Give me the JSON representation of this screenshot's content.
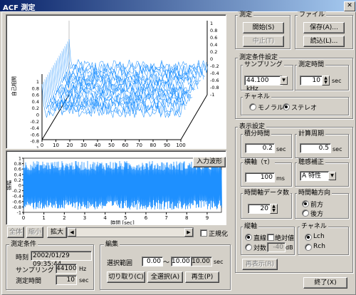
{
  "window": {
    "title": "ACF 測定"
  },
  "waterfall": {
    "xticks": [
      "0",
      "10",
      "20",
      "30",
      "40",
      "50",
      "60",
      "70",
      "80",
      "90",
      "100"
    ],
    "xlabel": "τ [ms]",
    "ylabel": "自己相関",
    "zticks_left": [
      "1",
      "0.8",
      "0.6",
      "0.4",
      "0.2",
      "0",
      "-0.2",
      "-0.4",
      "-0.6",
      "-0.8",
      "-1"
    ],
    "zticks_right": [
      "1",
      "0.8",
      "0.6",
      "0.4",
      "0.2",
      "0",
      "-0.2",
      "-0.4",
      "-0.6",
      "-0.8",
      "-1"
    ],
    "line_color": "#1e90ff"
  },
  "waveform": {
    "button_label": "入力波形",
    "xticks": [
      "0",
      "1",
      "2",
      "3",
      "4",
      "5",
      "6",
      "7",
      "8",
      "9"
    ],
    "xlabel": "時間 [sec]",
    "ylabel": "振幅",
    "yticks": [
      "1",
      "0.8",
      "0.6",
      "0.4",
      "0.2",
      "0",
      "-0.2",
      "-0.4",
      "-0.6",
      "-0.8",
      "-1"
    ],
    "fill_color": "#1e90ff"
  },
  "scrollctl": {
    "all": "全体",
    "shrink": "縮小",
    "zoom": "拡大",
    "normalize": "正規化"
  },
  "measure": {
    "group": "測定",
    "start": "開始(S)",
    "stop": "中止(T)"
  },
  "file": {
    "group": "ファイル",
    "save": "保存(A)...",
    "load": "読込(L)..."
  },
  "cond": {
    "group": "測定条件設定",
    "sampling_label": "サンプリング",
    "sampling_value": "44.100 kHz",
    "time_label": "測定時間",
    "time_value": "10",
    "time_unit": "sec",
    "channel_group": "チャネル",
    "mono": "モノラル",
    "stereo": "ステレオ"
  },
  "display": {
    "group": "表示設定",
    "integ_label": "積分時間",
    "integ_value": "0.2",
    "integ_unit": "sec",
    "period_label": "計算周期",
    "period_value": "0.5",
    "period_unit": "sec",
    "hor_label": "横軸（τ）",
    "hor_value": "100",
    "hor_unit": "ms",
    "aud_label": "聴感補正",
    "aud_value": "A 特性",
    "count_label": "時間軸データ数",
    "count_value": "20",
    "dir_label": "時間軸方向",
    "dir_front": "前方",
    "dir_back": "後方",
    "vert_group": "縦軸",
    "linear": "直線",
    "abs": "絶対値",
    "log": "対数",
    "log_value": "-40",
    "log_unit": "dB",
    "ch_group": "チャネル",
    "lch": "Lch",
    "rch": "Rch",
    "redisplay": "再表示(R)"
  },
  "condinfo": {
    "group": "測定条件",
    "time_label": "時刻",
    "time_value": "2002/01/29 09:35:44",
    "samp_label": "サンプリング",
    "samp_value": "44100",
    "samp_unit": "Hz",
    "dur_label": "測定時間",
    "dur_value": "10",
    "dur_unit": "sec"
  },
  "edit": {
    "group": "編集",
    "range_label": "選択範囲",
    "from": "0.00",
    "tilde": "〜",
    "to": "10.00",
    "len": "10.00",
    "unit": "sec",
    "cut": "切り取り(C)",
    "selall": "全選択(A)",
    "play": "再生(P)"
  },
  "footer": {
    "exit": "終了(X)"
  }
}
